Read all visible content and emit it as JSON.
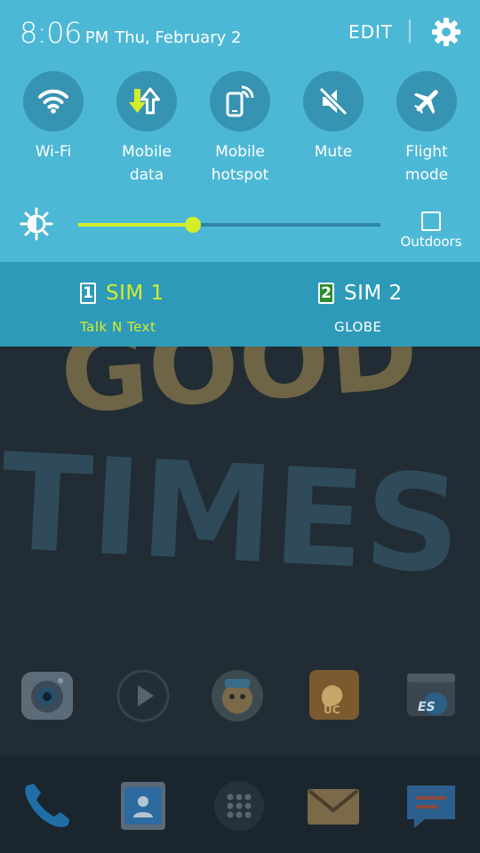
{
  "status": {
    "time": "8:06",
    "ampm": "PM",
    "date": "Thu, February 2"
  },
  "header": {
    "edit_label": "EDIT"
  },
  "toggles": [
    {
      "id": "wifi",
      "label_line1": "Wi-Fi",
      "label_line2": "",
      "icon": "wifi-icon",
      "active": true
    },
    {
      "id": "mobile-data",
      "label_line1": "Mobile",
      "label_line2": "data",
      "icon": "data-arrows-icon",
      "active": true
    },
    {
      "id": "mobile-hotspot",
      "label_line1": "Mobile",
      "label_line2": "hotspot",
      "icon": "hotspot-icon",
      "active": false
    },
    {
      "id": "mute",
      "label_line1": "Mute",
      "label_line2": "",
      "icon": "mute-icon",
      "active": false
    },
    {
      "id": "flight-mode",
      "label_line1": "Flight",
      "label_line2": "mode",
      "icon": "airplane-icon",
      "active": false
    }
  ],
  "brightness": {
    "level": 0.38,
    "outdoors_label": "Outdoors",
    "outdoors_checked": false
  },
  "sims": [
    {
      "number": "1",
      "name": "SIM 1",
      "carrier": "Talk N Text",
      "selected": true
    },
    {
      "number": "2",
      "name": "SIM 2",
      "carrier": "GLOBE",
      "selected": false
    }
  ],
  "wallpaper": {
    "text_line1": "GOOD",
    "text_line2": "TIMES"
  },
  "colors": {
    "panel": "#4db8d6",
    "sim_bar": "#2e9ab9",
    "accent": "#d4ed2b",
    "toggle_bg": "#3693b1"
  },
  "home_apps": [
    "camera-app-icon",
    "video-player-app-icon",
    "game-app-icon",
    "uc-browser-app-icon",
    "es-file-explorer-app-icon"
  ],
  "dock_apps": [
    "phone-app-icon",
    "contacts-app-icon",
    "app-drawer-icon",
    "email-app-icon",
    "messages-app-icon"
  ]
}
